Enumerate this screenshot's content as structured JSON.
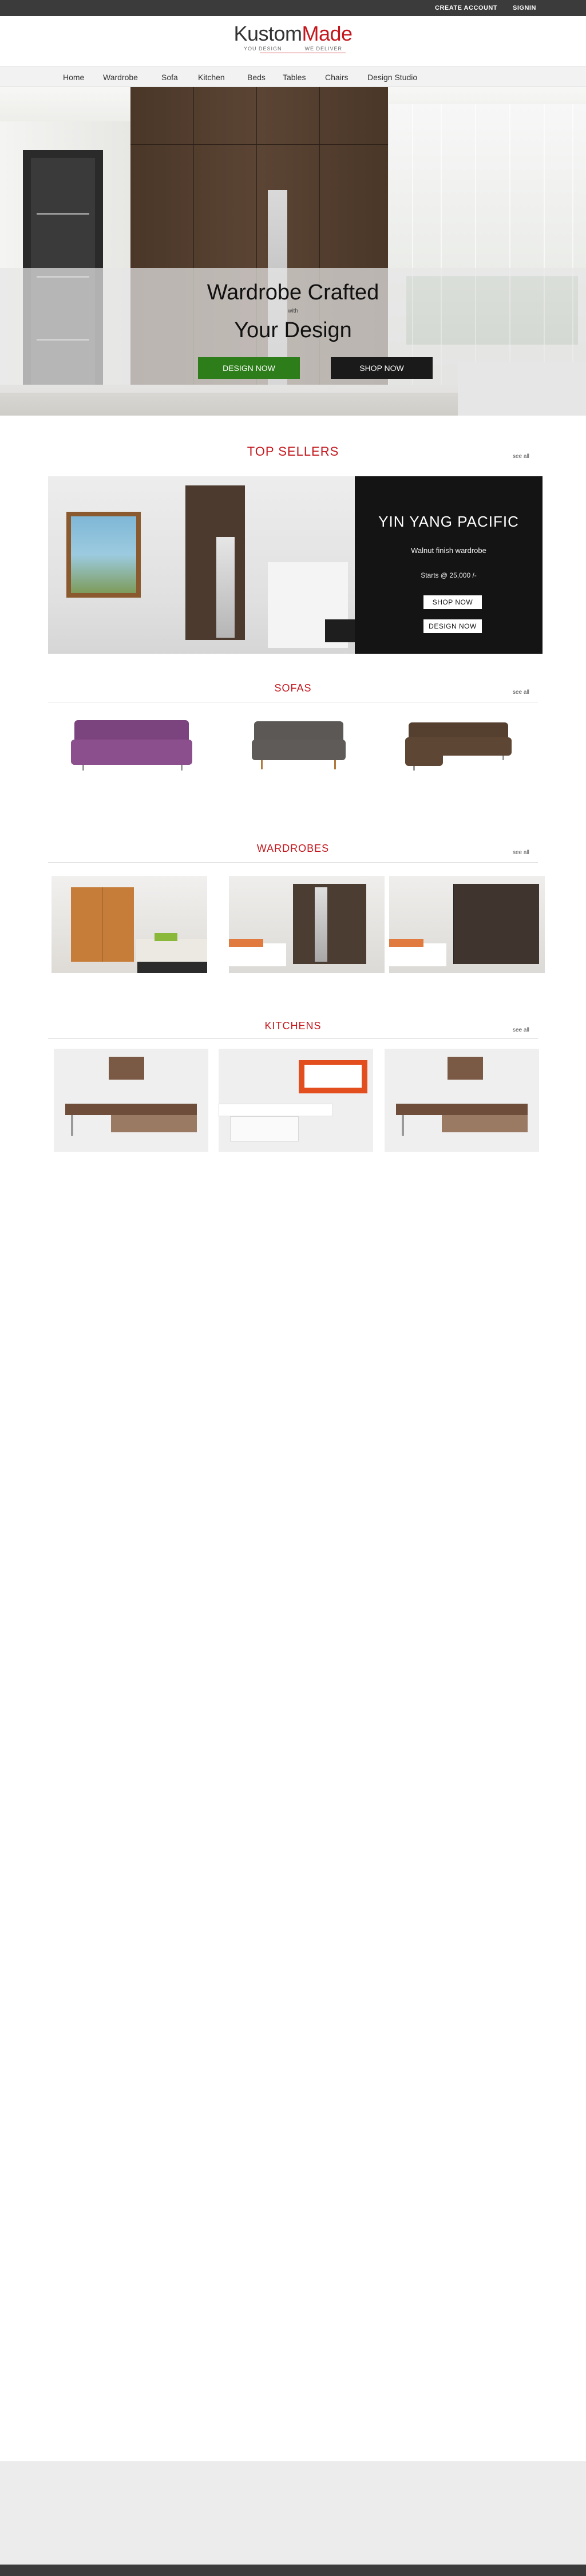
{
  "topbar": {
    "create_account": "CREATE ACCOUNT",
    "signin": "SIGNIN"
  },
  "logo": {
    "part1": "Kustom",
    "part2": "Made",
    "tag_left": "YOU DESIGN",
    "tag_right": "WE DELIVER"
  },
  "nav": {
    "items": [
      "Home",
      "Wardrobe",
      "Sofa",
      "Kitchen",
      "Beds",
      "Tables",
      "Chairs",
      "Design Studio"
    ]
  },
  "hero": {
    "line1": "Wardrobe Crafted",
    "with": "with",
    "line2": "Your Design",
    "design_button": "DESIGN NOW",
    "shop_button": "SHOP NOW"
  },
  "sections": {
    "top_sellers": {
      "title": "TOP SELLERS",
      "see_all": "see all"
    },
    "sofas": {
      "title": "SOFAS",
      "see_all": "see all"
    },
    "wardrobes": {
      "title": "WARDROBES",
      "see_all": "see all"
    },
    "kitchens": {
      "title": "KITCHENS",
      "see_all": "see all"
    }
  },
  "top_seller": {
    "name": "YIN YANG PACIFIC",
    "description": "Walnut finish wardrobe",
    "price": "Starts @ 25,000 /-",
    "shop_button": "SHOP NOW",
    "design_button": "DESIGN NOW"
  },
  "colors": {
    "brand_red": "#c4161c",
    "design_green": "#2d7d1a",
    "bar_dark": "#3b3b3b",
    "sofa_purple": "#8a4f8c",
    "sofa_grey": "#5e5b58",
    "sofa_brown": "#5e4634"
  }
}
